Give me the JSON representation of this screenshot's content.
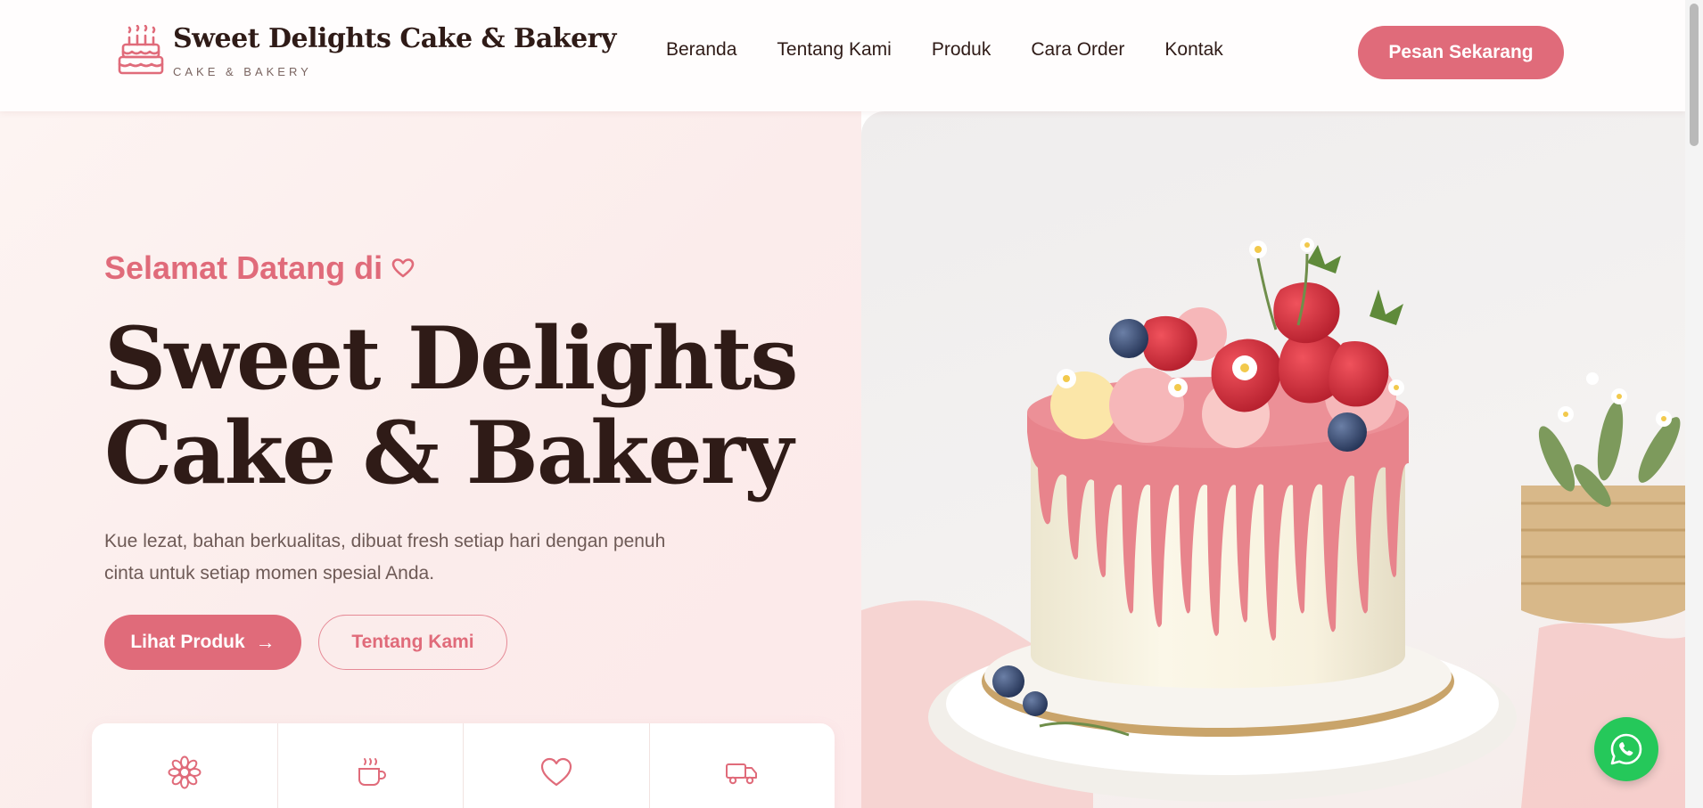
{
  "brand": {
    "name": "Sweet Delights Cake & Bakery",
    "tagline": "CAKE & BAKERY",
    "logo_icon": "birthday-cake-icon"
  },
  "nav": {
    "items": [
      "Beranda",
      "Tentang Kami",
      "Produk",
      "Cara Order",
      "Kontak"
    ]
  },
  "header_cta": "Pesan Sekarang",
  "hero": {
    "welcome": "Selamat Datang di",
    "welcome_icon": "heart-icon",
    "title_line1": "Sweet Delights",
    "title_line2": "Cake & Bakery",
    "description": "Kue lezat, bahan berkualitas, dibuat fresh setiap hari dengan penuh cinta untuk setiap momen spesial Anda.",
    "primary_button": "Lihat Produk",
    "primary_button_icon": "arrow-right-icon",
    "secondary_button": "Tentang Kami"
  },
  "features": {
    "icons": [
      "flower-icon",
      "coffee-cup-icon",
      "heart-icon",
      "delivery-truck-icon"
    ]
  },
  "floating": {
    "whatsapp_icon": "whatsapp-icon"
  },
  "colors": {
    "accent": "#e06b7a",
    "dark_text": "#2f1b17",
    "hero_bg": "#fbeceb",
    "whatsapp": "#25c85a"
  }
}
